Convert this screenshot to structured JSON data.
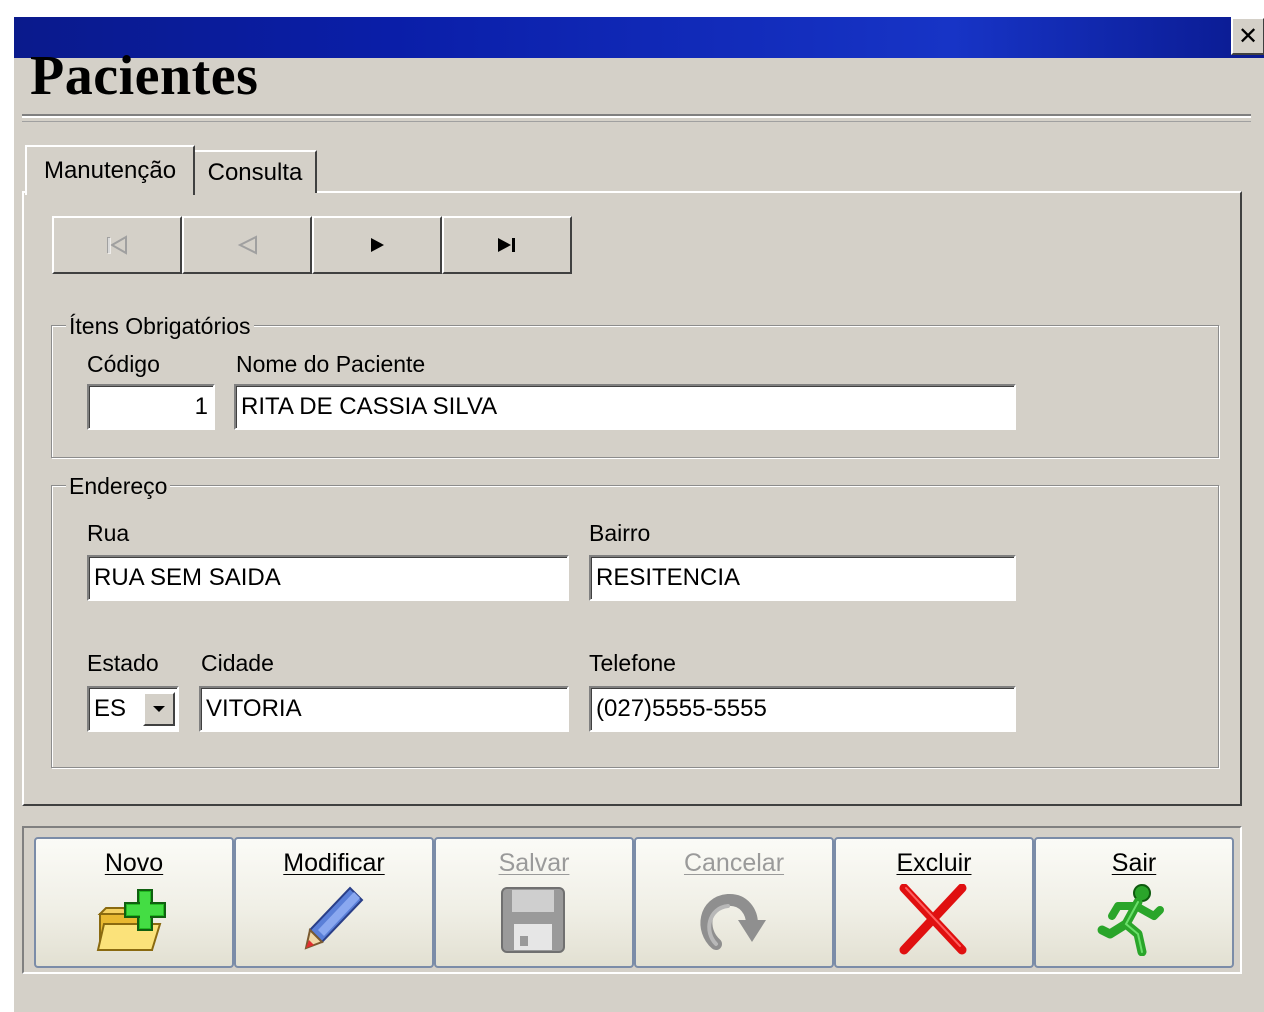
{
  "window": {
    "close_glyph": "✕",
    "title": "Pacientes"
  },
  "tabs": [
    {
      "label": "Manutenção",
      "active": true
    },
    {
      "label": "Consulta",
      "active": false
    }
  ],
  "navigator": {
    "buttons": [
      {
        "icon": "first-record-icon",
        "glyph": "⏮",
        "enabled": false
      },
      {
        "icon": "prior-record-icon",
        "glyph": "◁",
        "enabled": false
      },
      {
        "icon": "next-record-icon",
        "glyph": "▶",
        "enabled": true
      },
      {
        "icon": "last-record-icon",
        "glyph": "⏭",
        "enabled": true
      }
    ]
  },
  "required_group": {
    "legend": "Ítens Obrigatórios",
    "codigo_label": "Código",
    "codigo_value": "1",
    "nome_label": "Nome do Paciente",
    "nome_value": "RITA DE CASSIA SILVA"
  },
  "address_group": {
    "legend": "Endereço",
    "rua_label": "Rua",
    "rua_value": "RUA SEM SAIDA",
    "bairro_label": "Bairro",
    "bairro_value": "RESITENCIA",
    "estado_label": "Estado",
    "estado_value": "ES",
    "cidade_label": "Cidade",
    "cidade_value": "VITORIA",
    "telefone_label": "Telefone",
    "telefone_value": "(027)5555-5555"
  },
  "actions": [
    {
      "label": "Novo",
      "icon": "new-folder-icon",
      "enabled": true
    },
    {
      "label": "Modificar",
      "icon": "pencil-icon",
      "enabled": true
    },
    {
      "label": "Salvar",
      "icon": "floppy-disk-icon",
      "enabled": false
    },
    {
      "label": "Cancelar",
      "icon": "undo-arrow-icon",
      "enabled": false
    },
    {
      "label": "Excluir",
      "icon": "red-x-icon",
      "enabled": true
    },
    {
      "label": "Sair",
      "icon": "running-man-icon",
      "enabled": true
    }
  ],
  "colors": {
    "face": "#d4d0c8",
    "titlebar": "#0a1ea8",
    "delete_red": "#e01010",
    "exit_green": "#2aa52a",
    "plus_green": "#22bb22",
    "folder_yellow": "#f2d14a"
  }
}
